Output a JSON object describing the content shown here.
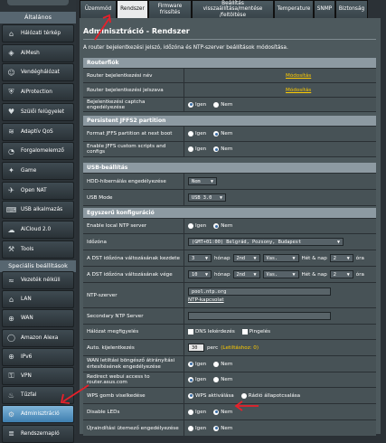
{
  "sidebar": {
    "section_general": "Általános",
    "section_advanced": "Speciális beállítások",
    "items": [
      {
        "label": "Hálózati térkép",
        "icon": "network-map-icon",
        "glyph": "⌂"
      },
      {
        "label": "AiMesh",
        "icon": "aimesh-icon",
        "glyph": "◈"
      },
      {
        "label": "Vendéghálózat",
        "icon": "guest-network-icon",
        "glyph": "☺"
      },
      {
        "label": "AiProtection",
        "icon": "shield-icon",
        "glyph": "⛨"
      },
      {
        "label": "Szülői felügyelet",
        "icon": "parental-control-icon",
        "glyph": "♥"
      },
      {
        "label": "Adaptív QoS",
        "icon": "qos-icon",
        "glyph": "≋"
      },
      {
        "label": "Forgalomelemző",
        "icon": "traffic-analyzer-icon",
        "glyph": "◔"
      },
      {
        "label": "Game",
        "icon": "game-icon",
        "glyph": "✦"
      },
      {
        "label": "Open NAT",
        "icon": "open-nat-icon",
        "glyph": "✈"
      },
      {
        "label": "USB alkalmazás",
        "icon": "usb-icon",
        "glyph": "⌨"
      },
      {
        "label": "AiCloud 2.0",
        "icon": "cloud-icon",
        "glyph": "☁"
      },
      {
        "label": "Tools",
        "icon": "tools-icon",
        "glyph": "⚒"
      }
    ],
    "advanced_items": [
      {
        "label": "Vezeték nélküli",
        "icon": "wireless-icon",
        "glyph": "≈"
      },
      {
        "label": "LAN",
        "icon": "lan-icon",
        "glyph": "⌂"
      },
      {
        "label": "WAN",
        "icon": "wan-icon",
        "glyph": "⊕"
      },
      {
        "label": "Amazon Alexa",
        "icon": "alexa-icon",
        "glyph": "◯"
      },
      {
        "label": "IPv6",
        "icon": "ipv6-icon",
        "glyph": "⊕"
      },
      {
        "label": "VPN",
        "icon": "vpn-icon",
        "glyph": "⚿"
      },
      {
        "label": "Tűzfal",
        "icon": "firewall-icon",
        "glyph": "♨"
      },
      {
        "label": "Adminisztráció",
        "icon": "admin-icon",
        "glyph": "⚙"
      },
      {
        "label": "Rendszernapló",
        "icon": "syslog-icon",
        "glyph": "≣"
      }
    ]
  },
  "tabs": [
    {
      "label": "Üzemmód"
    },
    {
      "label": "Rendszer"
    },
    {
      "label": "Firmware frissítés"
    },
    {
      "label": "Beállítás visszaállítása/mentése /feltöltése"
    },
    {
      "label": "Temperature"
    },
    {
      "label": "SNMP"
    },
    {
      "label": "Biztonság"
    }
  ],
  "page": {
    "title": "Adminisztráció - Rendszer",
    "description": "A router bejelentkezési jelszó, időzóna és NTP-szerver beállítások módosítása."
  },
  "common": {
    "yes": "Igen",
    "no": "Nem"
  },
  "router_login": {
    "header": "Routerfiók",
    "name_label": "Router bejelentkezési név",
    "name_link": "Módosítás",
    "password_label": "Router bejelentkezési jelszava",
    "password_link": "Módosítás",
    "captcha_label": "Bejelentkezési captcha engedélyezése",
    "captcha_value": "Igen"
  },
  "jffs": {
    "header": "Persistent JFFS2 partition",
    "format_label": "Format JFFS partition at next boot",
    "format_value": "Nem",
    "scripts_label": "Enable JFFS custom scripts and configs",
    "scripts_value": "Nem"
  },
  "usb": {
    "header": "USB-beállítás",
    "hibernation_label": "HDD-hibernálás engedélyezése",
    "hibernation_value": "Nem",
    "mode_label": "USB Mode",
    "mode_value": "USB 3.0"
  },
  "misc": {
    "header": "Egyszerű konfiguráció",
    "local_ntp_label": "Enable local NTP server",
    "local_ntp_value": "Nem",
    "timezone_label": "Időzóna",
    "timezone_value": "(GMT+01:00) Belgrád, Pozsony, Budapest",
    "dst_start_label": "A DST időzóna változásának kezdete",
    "dst_start": {
      "month": "3",
      "month_unit": "hónap",
      "week": "2nd",
      "day": "Vas.",
      "day_unit": "Hét & nap",
      "hour": "2",
      "hour_unit": "óra"
    },
    "dst_end_label": "A DST időzóna változásának vége",
    "dst_end": {
      "month": "10",
      "month_unit": "hónap",
      "week": "2nd",
      "day": "Vas.",
      "day_unit": "Hét & nap",
      "hour": "2",
      "hour_unit": "óra"
    },
    "ntp_label": "NTP-szerver",
    "ntp_value": "pool.ntp.org",
    "ntp_link": "NTP-kapcsolat",
    "ntp2_label": "Secondary NTP Server",
    "ntp2_value": "",
    "monitor_label": "Hálózat megfigyelés",
    "monitor_dns": "DNS lekérdezés",
    "monitor_ping": "Pingelés",
    "logout_label": "Auto. kijelentkezés",
    "logout_value": "30",
    "logout_unit": "perc",
    "logout_note": "(Letiltáshoz: 0)",
    "wan_redirect_label": "WAN letiltási böngésző átirányítási értesítésének engedélyezése",
    "wan_redirect_value": "Igen",
    "redirect_label": "Redirect webui access to router.asus.com",
    "redirect_value": "Igen",
    "wps_label": "WPS gomb viselkedése",
    "wps_opt1": "WPS aktiválása",
    "wps_opt2": "Rádió állapotcsalása",
    "wps_value": "WPS aktiválása",
    "leds_label": "Disable LEDs",
    "leds_value": "Nem",
    "reboot_label": "Újraindítási ütemező engedélyezése",
    "reboot_value": "Nem"
  },
  "colors": {
    "accent": "#ffcc00",
    "annotation_arrow": "#e8202a",
    "active_sidebar": "#4a8cc0"
  }
}
